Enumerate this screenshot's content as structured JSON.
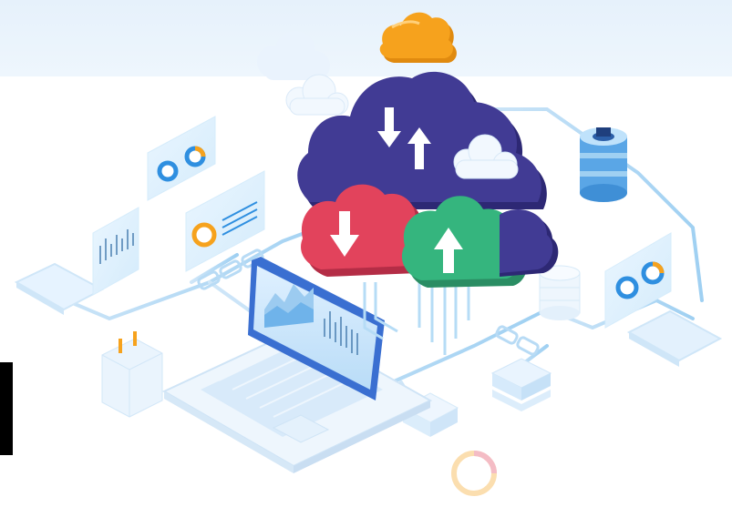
{
  "illustration": {
    "theme": "cloud data transfer",
    "colors": {
      "band": "#e9f3fc",
      "cloud_main": "#3f3a8c",
      "cloud_download": "#e2435c",
      "cloud_upload": "#34b37c",
      "cloud_small": "#f6a21d",
      "lines": "#a9d3f3",
      "panel": "#dcefff"
    },
    "icons": [
      "main-cloud-icon",
      "download-cloud-icon",
      "upload-cloud-icon",
      "orange-cloud-icon",
      "database-icon",
      "laptop-icon",
      "donut-chart-icon",
      "server-stack-icon",
      "power-plug-icon"
    ]
  }
}
